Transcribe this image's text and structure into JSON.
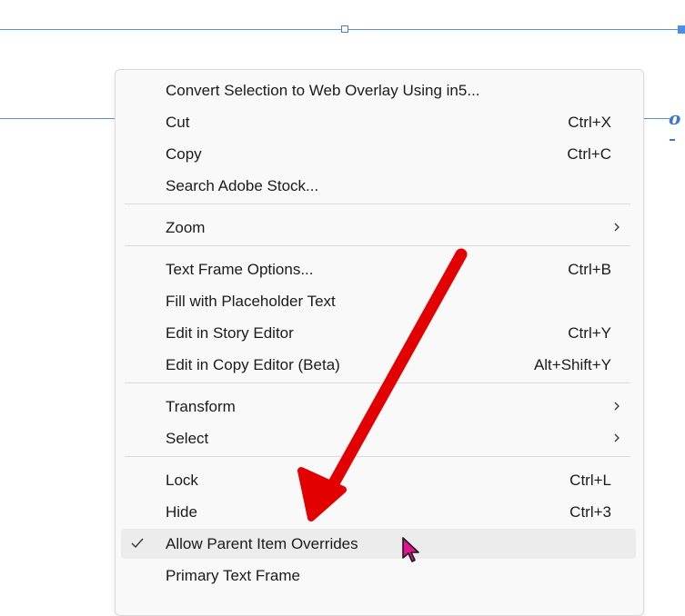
{
  "context_menu": {
    "groups": [
      [
        {
          "label": "Convert Selection to Web Overlay Using in5...",
          "shortcut": ""
        },
        {
          "label": "Cut",
          "shortcut": "Ctrl+X"
        },
        {
          "label": "Copy",
          "shortcut": "Ctrl+C"
        },
        {
          "label": "Search Adobe Stock...",
          "shortcut": ""
        }
      ],
      [
        {
          "label": "Zoom",
          "shortcut": "",
          "submenu": true
        }
      ],
      [
        {
          "label": "Text Frame Options...",
          "shortcut": "Ctrl+B"
        },
        {
          "label": "Fill with Placeholder Text",
          "shortcut": ""
        },
        {
          "label": "Edit in Story Editor",
          "shortcut": "Ctrl+Y"
        },
        {
          "label": "Edit in Copy Editor (Beta)",
          "shortcut": "Alt+Shift+Y"
        }
      ],
      [
        {
          "label": "Transform",
          "shortcut": "",
          "submenu": true
        },
        {
          "label": "Select",
          "shortcut": "",
          "submenu": true
        }
      ],
      [
        {
          "label": "Lock",
          "shortcut": "Ctrl+L"
        },
        {
          "label": "Hide",
          "shortcut": "Ctrl+3"
        },
        {
          "label": "Allow Parent Item Overrides",
          "shortcut": "",
          "checked": true,
          "highlighted": true
        },
        {
          "label": "Primary Text Frame",
          "shortcut": ""
        }
      ]
    ]
  },
  "canvas": {
    "stray_glyph": "o"
  },
  "colors": {
    "guide": "#5b8fd6",
    "arrow": "#e30000",
    "cursor": "#e0148c"
  }
}
